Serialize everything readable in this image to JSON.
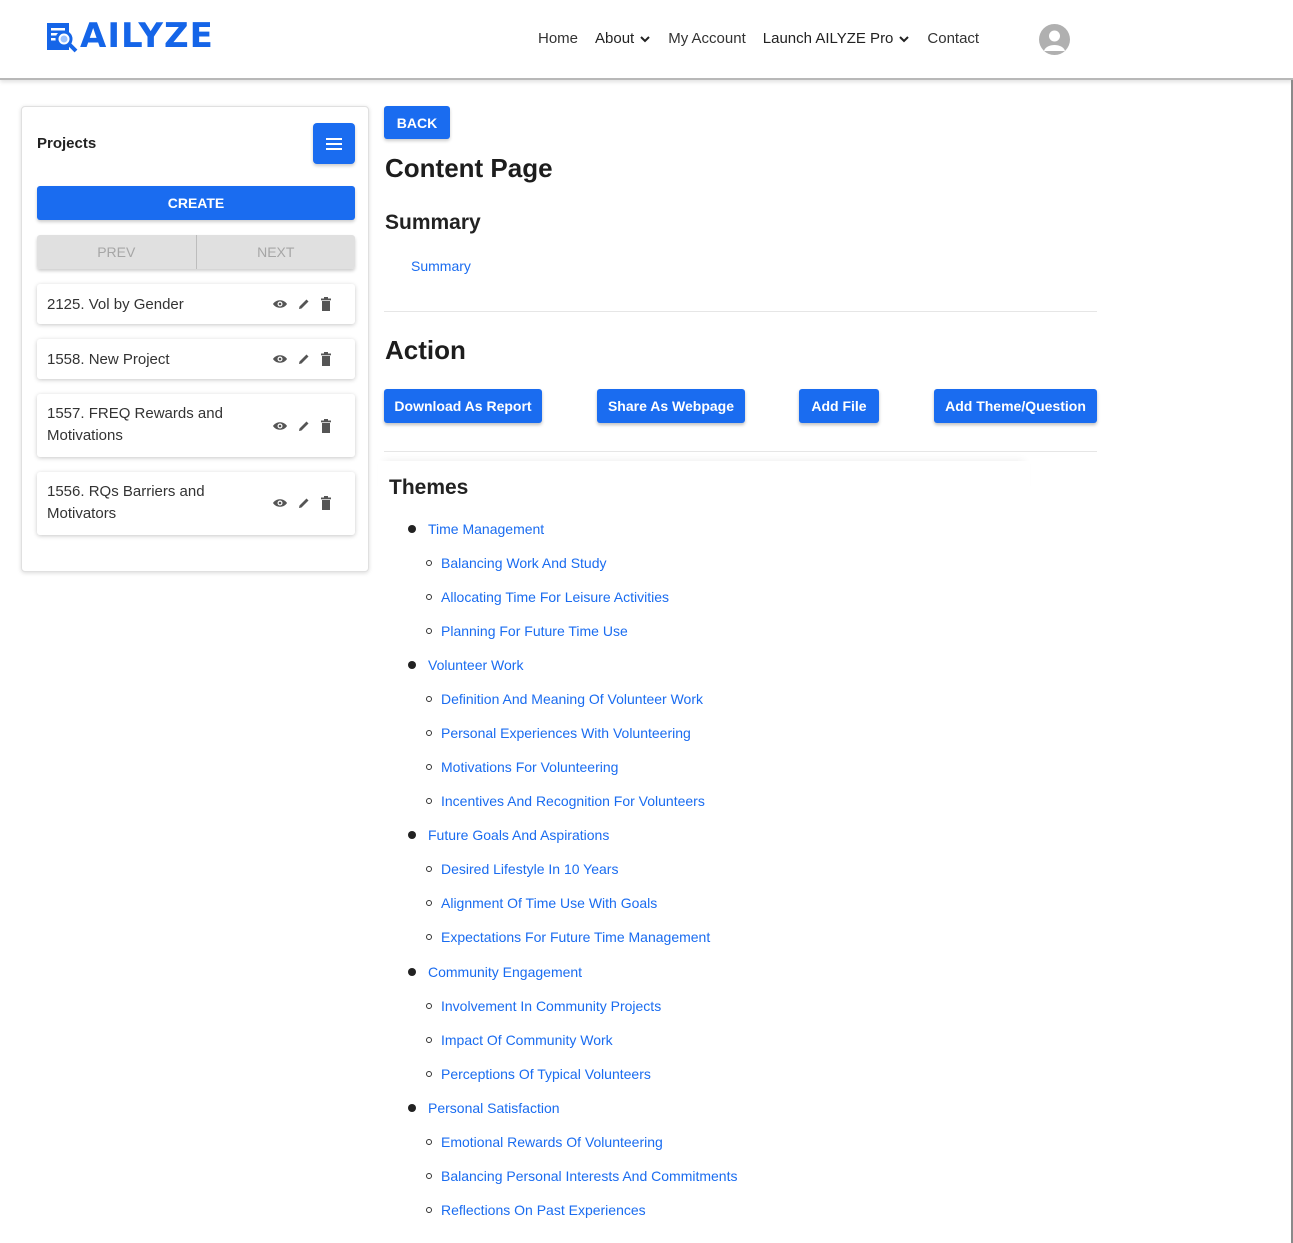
{
  "brand": {
    "name": "AILYZE"
  },
  "nav": {
    "home": "Home",
    "about": "About",
    "account": "My Account",
    "launch": "Launch AILYZE Pro",
    "contact": "Contact"
  },
  "sidebar": {
    "title": "Projects",
    "create": "CREATE",
    "prev": "PREV",
    "next": "NEXT",
    "projects": [
      {
        "name": "2125. Vol by Gender"
      },
      {
        "name": "1558. New Project"
      },
      {
        "name": "1557. FREQ Rewards and Motivations"
      },
      {
        "name": "1556. RQs Barriers and Motivators"
      }
    ]
  },
  "main": {
    "back": "BACK",
    "page_title": "Content Page",
    "summary_heading": "Summary",
    "summary_link": "Summary",
    "action_heading": "Action",
    "actions": [
      "Download As Report",
      "Share As Webpage",
      "Add File",
      "Add Theme/Question"
    ],
    "themes_heading": "Themes",
    "themes": [
      {
        "title": "Time Management",
        "subs": [
          "Balancing Work And Study",
          "Allocating Time For Leisure Activities",
          "Planning For Future Time Use"
        ]
      },
      {
        "title": "Volunteer Work",
        "subs": [
          "Definition And Meaning Of Volunteer Work",
          "Personal Experiences With Volunteering",
          "Motivations For Volunteering",
          "Incentives And Recognition For Volunteers"
        ]
      },
      {
        "title": "Future Goals And Aspirations",
        "subs": [
          "Desired Lifestyle In 10 Years",
          "Alignment Of Time Use With Goals",
          "Expectations For Future Time Management"
        ]
      },
      {
        "title": "Community Engagement",
        "subs": [
          "Involvement In Community Projects",
          "Impact Of Community Work",
          "Perceptions Of Typical Volunteers"
        ]
      },
      {
        "title": "Personal Satisfaction",
        "subs": [
          "Emotional Rewards Of Volunteering",
          "Balancing Personal Interests And Commitments",
          "Reflections On Past Experiences"
        ]
      }
    ]
  },
  "colors": {
    "primary": "#1a6cf0",
    "link": "#1a6cf0"
  }
}
